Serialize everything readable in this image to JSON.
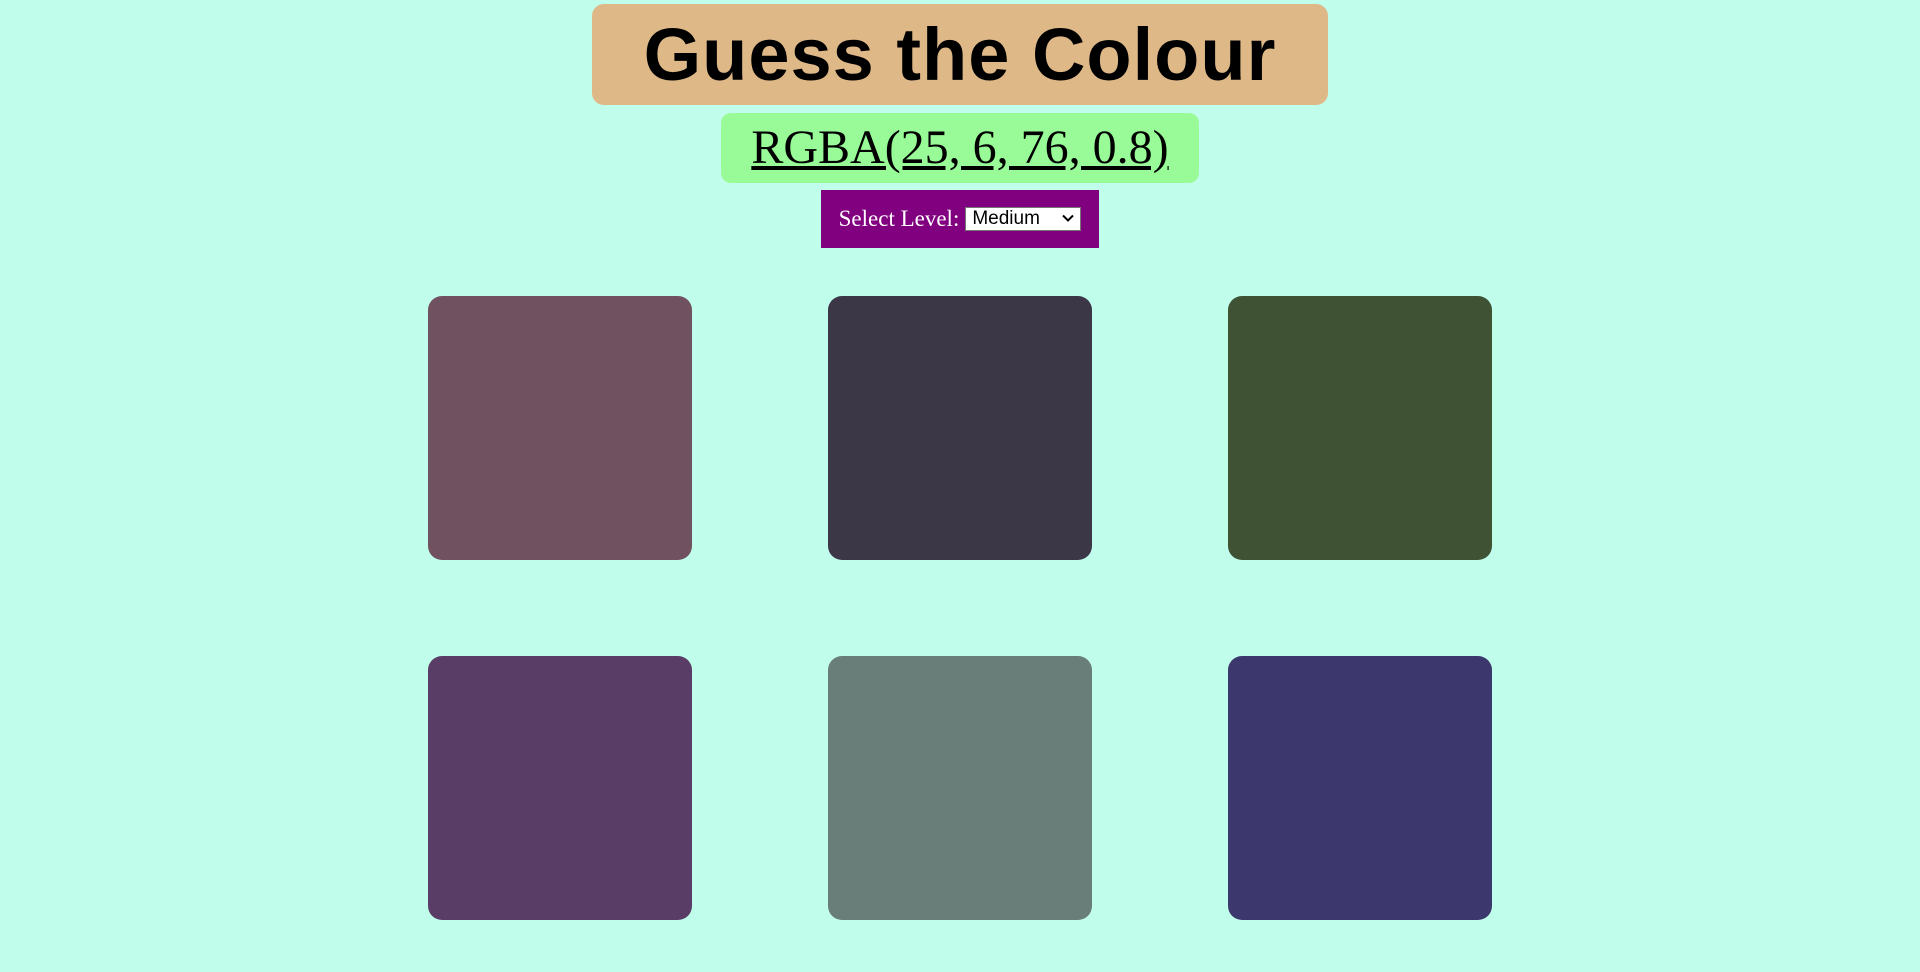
{
  "header": {
    "title": "Guess the Colour",
    "target_colour": "RGBA(25, 6, 76, 0.8)"
  },
  "level": {
    "label": "Select Level:",
    "selected": "Medium"
  },
  "swatches": [
    {
      "color": "#6f5160"
    },
    {
      "color": "#3b3746"
    },
    {
      "color": "#3f5233"
    },
    {
      "color": "#5a3d66"
    },
    {
      "color": "#697d79"
    },
    {
      "color": "#3c376c"
    }
  ],
  "colors": {
    "background": "#c0fdeb",
    "title_bg": "#deb887",
    "rgba_bg": "#98fb98",
    "level_bg": "#800080"
  }
}
